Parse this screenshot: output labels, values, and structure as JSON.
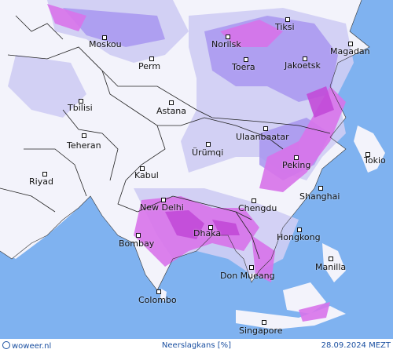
{
  "footer": {
    "brand": "woweer.nl",
    "product": "Neerslagkans [%]",
    "datetime": "28.09.2024 MEZT"
  },
  "cities": [
    {
      "name": "Moskou"
    },
    {
      "name": "Norilsk"
    },
    {
      "name": "Tiksi"
    },
    {
      "name": "Magadan"
    },
    {
      "name": "Perm"
    },
    {
      "name": "Toera"
    },
    {
      "name": "Jakoetsk"
    },
    {
      "name": "Tbilisi"
    },
    {
      "name": "Astana"
    },
    {
      "name": "Ulaanbaatar"
    },
    {
      "name": "Teheran"
    },
    {
      "name": "Ürümqi"
    },
    {
      "name": "Tokio"
    },
    {
      "name": "Peking"
    },
    {
      "name": "Riyad"
    },
    {
      "name": "Kabul"
    },
    {
      "name": "Shanghai"
    },
    {
      "name": "New Delhi"
    },
    {
      "name": "Chengdu"
    },
    {
      "name": "Dhaka"
    },
    {
      "name": "Hongkong"
    },
    {
      "name": "Bombay"
    },
    {
      "name": "Manilla"
    },
    {
      "name": "Don Mueang"
    },
    {
      "name": "Colombo"
    },
    {
      "name": "Singapore"
    }
  ],
  "colors": {
    "ocean": "#7fb2f0",
    "land": "#f4f4fb",
    "low_precip": "#c9c6f2",
    "mid_precip": "#a08ef0",
    "high_precip": "#d86ae8",
    "very_high_precip": "#c23fd6"
  }
}
